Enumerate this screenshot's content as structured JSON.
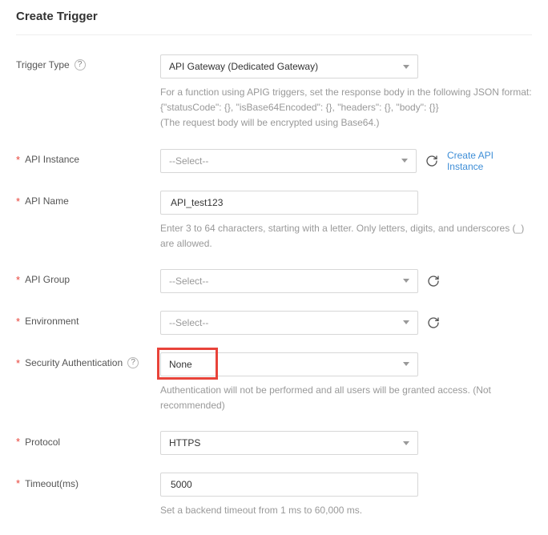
{
  "title": "Create Trigger",
  "fields": {
    "trigger_type": {
      "label": "Trigger Type",
      "value": "API Gateway (Dedicated Gateway)",
      "help1": "For a function using APIG triggers, set the response body in the following JSON format:",
      "help2": "{\"statusCode\": {}, \"isBase64Encoded\": {}, \"headers\": {}, \"body\": {}}",
      "help3": "(The request body will be encrypted using Base64.)"
    },
    "api_instance": {
      "label": "API Instance",
      "placeholder": "--Select--",
      "link": "Create API Instance"
    },
    "api_name": {
      "label": "API Name",
      "value": "API_test123",
      "help": "Enter 3 to 64 characters, starting with a letter. Only letters, digits, and underscores (_) are allowed."
    },
    "api_group": {
      "label": "API Group",
      "placeholder": "--Select--"
    },
    "environment": {
      "label": "Environment",
      "placeholder": "--Select--"
    },
    "security": {
      "label": "Security Authentication",
      "value": "None",
      "help": "Authentication will not be performed and all users will be granted access. (Not recommended)"
    },
    "protocol": {
      "label": "Protocol",
      "value": "HTTPS"
    },
    "timeout": {
      "label": "Timeout(ms)",
      "value": "5000",
      "help": "Set a backend timeout from 1 ms to 60,000 ms."
    }
  }
}
